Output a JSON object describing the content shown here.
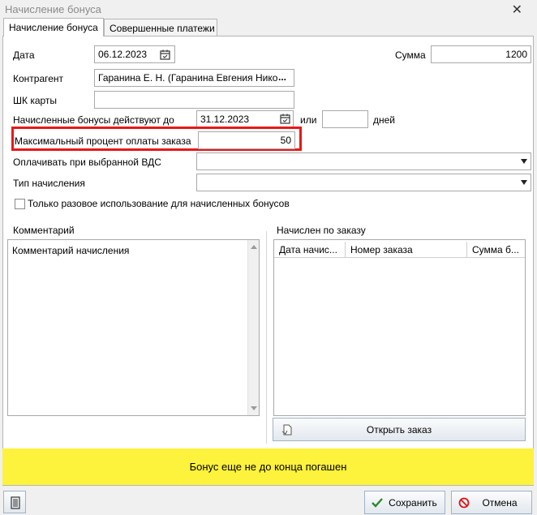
{
  "window": {
    "title": "Начисление бонуса",
    "close_glyph": "✕"
  },
  "tabs": [
    {
      "label": "Начисление бонуса",
      "active": true
    },
    {
      "label": "Совершенные платежи",
      "active": false
    }
  ],
  "form": {
    "date": {
      "label": "Дата",
      "value": "06.12.2023",
      "icon": "calendar-icon"
    },
    "sum": {
      "label": "Сумма",
      "value": "1200"
    },
    "counterparty": {
      "label": "Контрагент",
      "value": "Гаранина Е. Н. (Гаранина Евгения Нико",
      "button": "..."
    },
    "card_barcode": {
      "label": "ШК карты",
      "value": ""
    },
    "valid_until": {
      "label": "Начисленные бонусы действуют до",
      "value": "31.12.2023",
      "or": "или",
      "days_value": "",
      "days_label": "дней"
    },
    "max_percent": {
      "label": "Максимальный процент оплаты заказа",
      "value": "50"
    },
    "pay_vds": {
      "label": "Оплачивать при выбранной ВДС",
      "value": ""
    },
    "accrual_type": {
      "label": "Тип начисления",
      "value": ""
    },
    "one_time": {
      "label": "Только разовое использование для начисленных бонусов",
      "checked": false
    }
  },
  "comment": {
    "label": "Комментарий",
    "text": "Комментарий начисления"
  },
  "order_accrual": {
    "label": "Начислен по заказу",
    "columns": [
      "Дата начис...",
      "Номер заказа",
      "Сумма б..."
    ],
    "rows": [],
    "open_button": "Открыть заказ"
  },
  "status_banner": {
    "text": "Бонус еще не до конца погашен",
    "color": "#fdf23c"
  },
  "footer": {
    "save": "Сохранить",
    "cancel": "Отмена"
  }
}
